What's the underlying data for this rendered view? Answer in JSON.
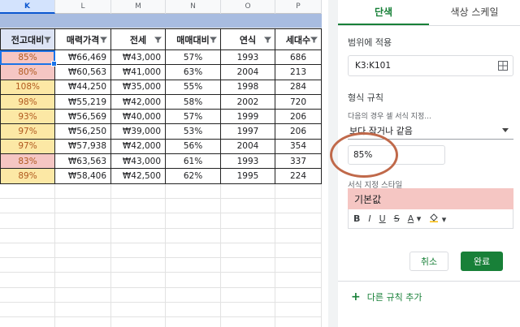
{
  "sheet": {
    "columns": [
      "K",
      "L",
      "M",
      "N",
      "O",
      "P"
    ],
    "headers": [
      "전고대비",
      "매력가격",
      "전세",
      "매매대비",
      "연식",
      "세대수"
    ],
    "rows": [
      {
        "k": "85%",
        "k_color": "red",
        "l": "₩66,469",
        "m": "₩43,000",
        "n": "57%",
        "o": "1993",
        "p": "686"
      },
      {
        "k": "80%",
        "k_color": "red",
        "l": "₩60,563",
        "m": "₩41,000",
        "n": "63%",
        "o": "2004",
        "p": "213"
      },
      {
        "k": "108%",
        "k_color": "yellow",
        "l": "₩44,250",
        "m": "₩35,000",
        "n": "55%",
        "o": "1998",
        "p": "284"
      },
      {
        "k": "98%",
        "k_color": "yellow",
        "l": "₩55,219",
        "m": "₩42,000",
        "n": "58%",
        "o": "2002",
        "p": "720"
      },
      {
        "k": "93%",
        "k_color": "yellow",
        "l": "₩56,569",
        "m": "₩40,000",
        "n": "57%",
        "o": "1999",
        "p": "206"
      },
      {
        "k": "97%",
        "k_color": "yellow",
        "l": "₩56,250",
        "m": "₩39,000",
        "n": "53%",
        "o": "1997",
        "p": "206"
      },
      {
        "k": "97%",
        "k_color": "yellow",
        "l": "₩57,938",
        "m": "₩42,000",
        "n": "56%",
        "o": "2004",
        "p": "354"
      },
      {
        "k": "83%",
        "k_color": "red",
        "l": "₩63,563",
        "m": "₩43,000",
        "n": "61%",
        "o": "1993",
        "p": "337"
      },
      {
        "k": "89%",
        "k_color": "yellow",
        "l": "₩58,406",
        "m": "₩42,500",
        "n": "62%",
        "o": "1995",
        "p": "224"
      }
    ]
  },
  "panel": {
    "tab_single": "단색",
    "tab_scale": "색상 스케일",
    "range_label": "범위에 적용",
    "range_value": "K3:K101",
    "rules_label": "형식 규칙",
    "condition_hint": "다음의 경우 셀 서식 지정...",
    "condition_value": "보다 작거나 같음",
    "value": "85%",
    "format_style_label": "서식 지정 스타일",
    "preview_text": "기본값",
    "cancel": "취소",
    "done": "완료",
    "add_rule": "다른 규칙 추가"
  },
  "colors": {
    "accent": "#188038",
    "red_fill": "#f5c6c3",
    "yellow_fill": "#fce8a5",
    "annotation_circle": "#c0694a"
  }
}
